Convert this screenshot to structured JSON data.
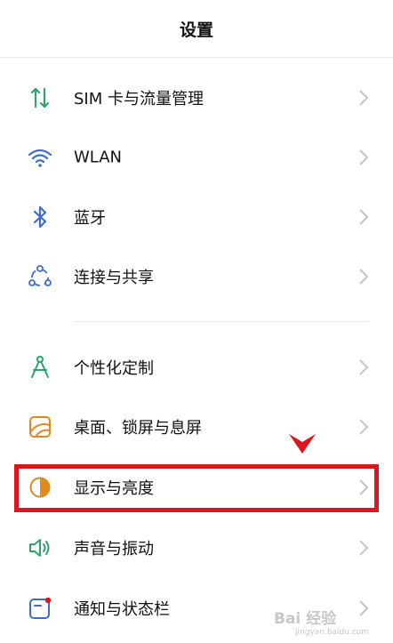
{
  "header": {
    "title": "设置"
  },
  "items": [
    {
      "label": "SIM 卡与流量管理",
      "icon": "sim-data-icon",
      "color": "#2ea36b"
    },
    {
      "label": "WLAN",
      "icon": "wifi-icon",
      "color": "#3d6ccf"
    },
    {
      "label": "蓝牙",
      "icon": "bluetooth-icon",
      "color": "#3d6ccf"
    },
    {
      "label": "连接与共享",
      "icon": "connection-share-icon",
      "color": "#3d6ccf"
    },
    {
      "label": "个性化定制",
      "icon": "personalization-icon",
      "color": "#2ea36b"
    },
    {
      "label": "桌面、锁屏与息屏",
      "icon": "wallpaper-icon",
      "color": "#e08a1e"
    },
    {
      "label": "显示与亮度",
      "icon": "brightness-icon",
      "color": "#e08a1e"
    },
    {
      "label": "声音与振动",
      "icon": "sound-icon",
      "color": "#2ea36b"
    },
    {
      "label": "通知与状态栏",
      "icon": "notification-icon",
      "color": "#3d6ccf"
    }
  ],
  "annotation": {
    "highlight_color": "#e0141c"
  },
  "watermark": {
    "text": "Bai 经验",
    "sub": "jingyan.baidu.com"
  }
}
